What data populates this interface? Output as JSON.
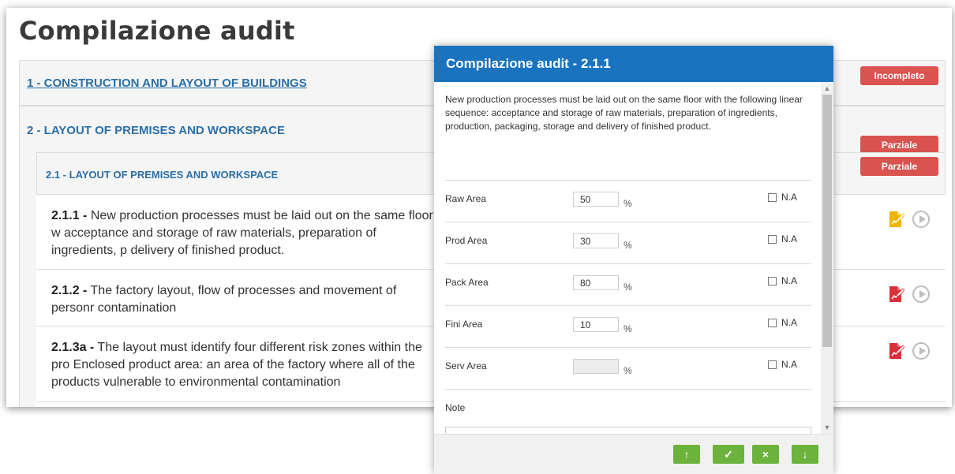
{
  "page": {
    "title": "Compilazione audit"
  },
  "sections": [
    {
      "title": "1 - CONSTRUCTION AND LAYOUT OF BUILDINGS",
      "status": "Incompleto"
    },
    {
      "title": "2 - LAYOUT OF PREMISES AND WORKSPACE",
      "status": "Parziale"
    }
  ],
  "subsection": {
    "title": "2.1 - LAYOUT OF PREMISES AND WORKSPACE",
    "status": "Parziale"
  },
  "questions": [
    {
      "code": "2.1.1 -",
      "text": "New production processes must be laid out on the same floor w acceptance and storage of raw materials, preparation of ingredients, p delivery of finished product.",
      "icon_color": "#f0b400"
    },
    {
      "code": "2.1.2 -",
      "text": "The factory layout, flow of processes and movement of personr contamination",
      "icon_color": "#d9303a"
    },
    {
      "code": "2.1.3a -",
      "text": "The layout must identify four different risk zones within the pro Enclosed product area: an area of the factory where all of the products vulnerable to environmental contamination",
      "icon_color": "#d9303a"
    }
  ],
  "modal": {
    "title": "Compilazione audit - 2.1.1",
    "description": "New production processes must be laid out on the same floor with the following linear sequence: acceptance and storage of raw materials, preparation of ingredients, production, packaging, storage and delivery of finished product.",
    "fields": [
      {
        "label": "Raw Area",
        "value": "50",
        "unit": "%",
        "na_label": "N.A",
        "disabled": false
      },
      {
        "label": "Prod Area",
        "value": "30",
        "unit": "%",
        "na_label": "N.A",
        "disabled": false
      },
      {
        "label": "Pack Area",
        "value": "80",
        "unit": "%",
        "na_label": "N.A",
        "disabled": false
      },
      {
        "label": "Fini Area",
        "value": "10",
        "unit": "%",
        "na_label": "N.A",
        "disabled": false
      },
      {
        "label": "Serv Area",
        "value": "",
        "unit": "%",
        "na_label": "N.A",
        "disabled": true
      }
    ],
    "note_label": "Note",
    "buttons": {
      "up": "↑",
      "ok": "✓",
      "cancel": "×",
      "down": "↓"
    }
  },
  "colors": {
    "accent": "#1a73bf",
    "danger": "#d9534f",
    "success": "#6cb33e",
    "link": "#2a6fa8"
  }
}
